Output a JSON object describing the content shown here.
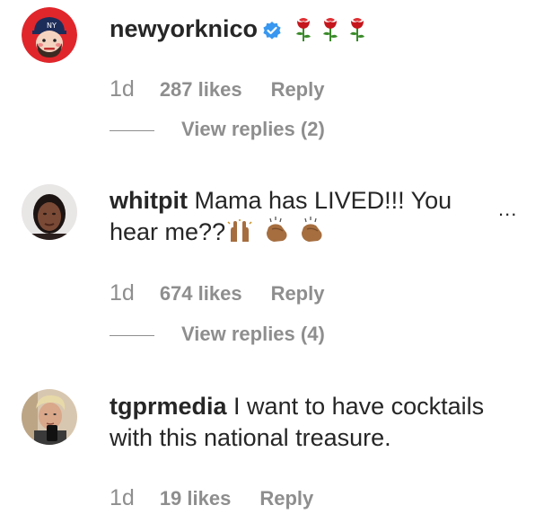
{
  "comments": [
    {
      "username": "newyorknico",
      "verified": true,
      "text": "",
      "time": "1d",
      "likes": "287 likes",
      "reply": "Reply",
      "view_replies": "View replies (2)"
    },
    {
      "username": "whitpit",
      "text_line1": "Mama has LIVED!!! You",
      "text_line2": "hear me??",
      "time": "1d",
      "likes": "674 likes",
      "reply": "Reply",
      "view_replies": "View replies (4)",
      "more": "..."
    },
    {
      "username": "tgprmedia",
      "text_line1": "I want to have cocktails",
      "text_line2": "with this national treasure.",
      "time": "1d",
      "likes": "19 likes",
      "reply": "Reply"
    }
  ],
  "icons": {
    "verified": "verified-badge-icon",
    "rose": "rose-emoji-icon",
    "raised_hands": "raised-hands-emoji-icon",
    "clapping": "clapping-hands-emoji-icon",
    "more": "more-options-icon"
  },
  "colors": {
    "text": "#262626",
    "secondary": "#8e8e8e",
    "verified_blue": "#3897f0"
  }
}
